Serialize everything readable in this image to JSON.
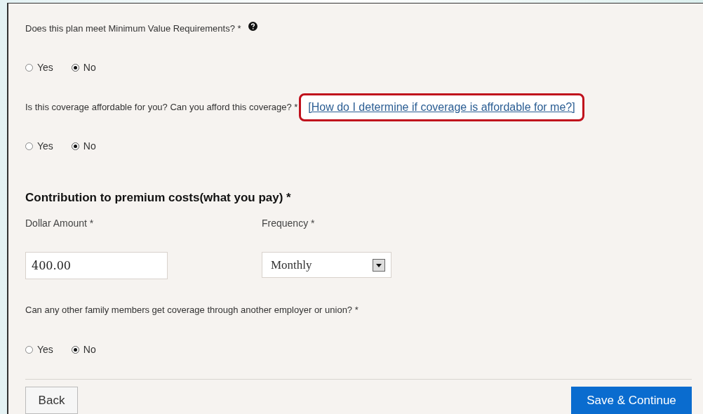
{
  "questions_top": [
    {
      "text": "Does this plan meet Minimum Value Requirements? *",
      "help": true,
      "options": [
        {
          "label": "Yes",
          "selected": false
        },
        {
          "label": "No",
          "selected": true
        }
      ]
    },
    {
      "text": "Is this coverage affordable for you? Can you afford this coverage? *",
      "link": {
        "text": "[How do I determine if coverage is affordable for me?]",
        "highlighted": true
      },
      "options": [
        {
          "label": "Yes",
          "selected": false
        },
        {
          "label": "No",
          "selected": true
        }
      ]
    }
  ],
  "contribution": {
    "heading": "Contribution to premium costs(what you pay) *",
    "amount": {
      "label": "Dollar Amount *",
      "value": "400.00"
    },
    "frequency": {
      "label": "Frequency *",
      "value": "Monthly"
    }
  },
  "questions_bottom": [
    {
      "text": "Can any other family members get coverage through another employer or union? *",
      "options": [
        {
          "label": "Yes",
          "selected": false
        },
        {
          "label": "No",
          "selected": true
        }
      ]
    }
  ],
  "buttons": {
    "back": "Back",
    "save": "Save & Continue"
  }
}
